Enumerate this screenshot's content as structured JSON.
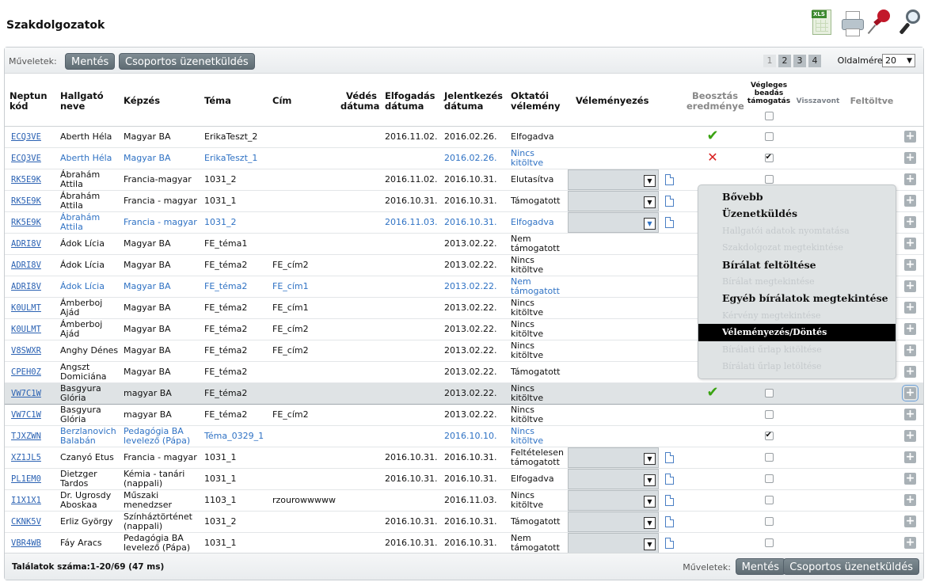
{
  "page": {
    "title": "Szakdolgozatok"
  },
  "top_icons": [
    {
      "name": "excel-export-icon",
      "label": "XLS"
    },
    {
      "name": "printer-icon"
    },
    {
      "name": "pin-icon"
    },
    {
      "name": "magnifier-icon"
    }
  ],
  "toolbar": {
    "label": "Műveletek:",
    "save": "Mentés",
    "group_message": "Csoportos üzenetküldés",
    "pages": [
      "1",
      "2",
      "3",
      "4"
    ],
    "current_page": "1",
    "page_size_label": "Oldalméret",
    "page_size_value": "20"
  },
  "columns": {
    "neptun": "Neptun kód",
    "student": "Hallgató neve",
    "program": "Képzés",
    "topic": "Téma",
    "title": "Cím",
    "defense_date": "Védés dátuma",
    "accept_date": "Elfogadás dátuma",
    "apply_date": "Jelentkezés dátuma",
    "supervisor_opinion": "Oktatói vélemény",
    "opinion": "Véleményezés",
    "assignment_result": "Beosztás eredménye",
    "final_submit": "Végleges beadás támogatás",
    "withdrawn": "Visszavont",
    "uploaded": "Feltöltve"
  },
  "rows": [
    {
      "neptun": "ECQ3VE",
      "name": "Aberth Héla",
      "program": "Magyar BA",
      "topic": "ErikaTeszt_2",
      "title": "",
      "defense": "",
      "accept": "2016.11.02.",
      "apply": "2016.02.26.",
      "opinion": "Elfogadva",
      "dropdown": false,
      "result": "check",
      "final": false,
      "blue": false
    },
    {
      "neptun": "ECQ3VE",
      "name": "Aberth Héla",
      "program": "Magyar BA",
      "topic": "ErikaTeszt_1",
      "title": "",
      "defense": "",
      "accept": "",
      "apply": "2016.02.26.",
      "opinion": "Nincs kitöltve",
      "dropdown": false,
      "result": "x",
      "final": true,
      "blue": true
    },
    {
      "neptun": "RK5E9K",
      "name": "Ábrahám Attila",
      "program": "Francia-magyar",
      "topic": "1031_2",
      "title": "",
      "defense": "",
      "accept": "2016.11.02.",
      "apply": "2016.10.31.",
      "opinion": "Elutasítva",
      "dropdown": true,
      "result": "",
      "final": false,
      "blue": false
    },
    {
      "neptun": "RK5E9K",
      "name": "Ábrahám Attila",
      "program": "Francia - magyar",
      "topic": "1031_1",
      "title": "",
      "defense": "",
      "accept": "2016.10.31.",
      "apply": "2016.10.31.",
      "opinion": "Támogatott",
      "dropdown": true,
      "result": "",
      "final": false,
      "blue": false
    },
    {
      "neptun": "RK5E9K",
      "name": "Ábrahám Attila",
      "program": "Francia - magyar",
      "topic": "1031_2",
      "title": "",
      "defense": "",
      "accept": "2016.11.03.",
      "apply": "2016.10.31.",
      "opinion": "Elfogadva",
      "dropdown": true,
      "result": "",
      "final": false,
      "blue": true
    },
    {
      "neptun": "ADRI8V",
      "name": "Ádok Lícia",
      "program": "Magyar BA",
      "topic": "FE_téma1",
      "title": "",
      "defense": "",
      "accept": "",
      "apply": "2013.02.22.",
      "opinion": "Nem támogatott",
      "dropdown": false,
      "result": "",
      "final": false,
      "blue": false
    },
    {
      "neptun": "ADRI8V",
      "name": "Ádok Lícia",
      "program": "Magyar BA",
      "topic": "FE_téma2",
      "title": "FE_cím2",
      "defense": "",
      "accept": "",
      "apply": "2013.02.22.",
      "opinion": "Nincs kitöltve",
      "dropdown": false,
      "result": "",
      "final": false,
      "blue": false
    },
    {
      "neptun": "ADRI8V",
      "name": "Ádok Lícia",
      "program": "Magyar BA",
      "topic": "FE_téma2",
      "title": "FE_cím1",
      "defense": "",
      "accept": "",
      "apply": "2013.02.22.",
      "opinion": "Nem támogatott",
      "dropdown": false,
      "result": "",
      "final": false,
      "blue": true
    },
    {
      "neptun": "K0ULMT",
      "name": "Ámberboj Ajád",
      "program": "Magyar BA",
      "topic": "FE_téma2",
      "title": "FE_cím1",
      "defense": "",
      "accept": "",
      "apply": "2013.02.22.",
      "opinion": "Nincs kitöltve",
      "dropdown": false,
      "result": "",
      "final": false,
      "blue": false
    },
    {
      "neptun": "K0ULMT",
      "name": "Ámberboj Ajád",
      "program": "Magyar BA",
      "topic": "FE_téma2",
      "title": "FE_cím2",
      "defense": "",
      "accept": "",
      "apply": "2013.02.22.",
      "opinion": "Nincs kitöltve",
      "dropdown": false,
      "result": "",
      "final": false,
      "blue": false
    },
    {
      "neptun": "V8SWXR",
      "name": "Anghy Dénes",
      "program": "Magyar BA",
      "topic": "FE_téma2",
      "title": "FE_cím2",
      "defense": "",
      "accept": "",
      "apply": "2013.02.22.",
      "opinion": "Nincs kitöltve",
      "dropdown": false,
      "result": "",
      "final": false,
      "blue": false
    },
    {
      "neptun": "CPEH0Z",
      "name": "Angszt Domiciána",
      "program": "Magyar BA",
      "topic": "FE_téma2",
      "title": "",
      "defense": "",
      "accept": "",
      "apply": "2013.02.22.",
      "opinion": "Támogatott",
      "dropdown": false,
      "result": "",
      "final": false,
      "blue": false
    },
    {
      "neptun": "VW7C1W",
      "name": "Basgyura Glória",
      "program": "magyar BA",
      "topic": "FE_téma2",
      "title": "",
      "defense": "",
      "accept": "",
      "apply": "2013.02.22.",
      "opinion": "Nincs kitöltve",
      "dropdown": false,
      "result": "check",
      "final": false,
      "blue": false,
      "selected": true
    },
    {
      "neptun": "VW7C1W",
      "name": "Basgyura Glória",
      "program": "magyar BA",
      "topic": "FE_téma2",
      "title": "FE_cím2",
      "defense": "",
      "accept": "",
      "apply": "2013.02.22.",
      "opinion": "Nincs kitöltve",
      "dropdown": false,
      "result": "",
      "final": false,
      "blue": false
    },
    {
      "neptun": "TJXZWN",
      "name": "Berzlanovich Balabán",
      "program": "Pedagógia BA levelező (Pápa)",
      "topic": "Téma_0329_1",
      "title": "",
      "defense": "",
      "accept": "",
      "apply": "2016.10.10.",
      "opinion": "Nincs kitöltve",
      "dropdown": false,
      "result": "",
      "final": true,
      "blue": true
    },
    {
      "neptun": "XZ1JL5",
      "name": "Czanyó Etus",
      "program": "Francia - magyar",
      "topic": "1031_1",
      "title": "",
      "defense": "",
      "accept": "2016.10.31.",
      "apply": "2016.10.31.",
      "opinion": "Feltételesen támogatott",
      "dropdown": true,
      "result": "",
      "final": false,
      "blue": false
    },
    {
      "neptun": "PL1EM0",
      "name": "Dietzger Tardos",
      "program": "Kémia - tanári (nappali)",
      "topic": "1031_1",
      "title": "",
      "defense": "",
      "accept": "2016.10.31.",
      "apply": "2016.10.31.",
      "opinion": "Elfogadva",
      "dropdown": true,
      "result": "",
      "final": false,
      "blue": false
    },
    {
      "neptun": "I1X1X1",
      "name": "Dr. Ugrosdy Aboskaa",
      "program": "Műszaki menedzser",
      "topic": "1103_1",
      "title": "rzourowwwww...",
      "defense": "",
      "accept": "",
      "apply": "2016.11.03.",
      "opinion": "Nincs kitöltve",
      "dropdown": true,
      "result": "",
      "final": false,
      "blue": false
    },
    {
      "neptun": "CKNK5V",
      "name": "Erliz György",
      "program": "Színháztörténet (nappali)",
      "topic": "1031_2",
      "title": "",
      "defense": "",
      "accept": "2016.10.31.",
      "apply": "2016.10.31.",
      "opinion": "Támogatott",
      "dropdown": true,
      "result": "",
      "final": false,
      "blue": false
    },
    {
      "neptun": "VBR4WB",
      "name": "Fáy Aracs",
      "program": "Pedagógia BA levelező (Pápa)",
      "topic": "1031_1",
      "title": "",
      "defense": "",
      "accept": "2016.10.31.",
      "apply": "2016.10.31.",
      "opinion": "Nem támogatott",
      "dropdown": true,
      "result": "",
      "final": false,
      "blue": false
    }
  ],
  "context_menu": [
    {
      "label": "Bővebb",
      "state": "enabled"
    },
    {
      "label": "Üzenetküldés",
      "state": "enabled"
    },
    {
      "label": "Hallgatói adatok nyomtatása",
      "state": "disabled"
    },
    {
      "label": "Szakdolgozat megtekintése",
      "state": "disabled"
    },
    {
      "label": "Bírálat feltöltése",
      "state": "enabled"
    },
    {
      "label": "Bírálat megtekintése",
      "state": "disabled"
    },
    {
      "label": "Egyéb bírálatok megtekintése",
      "state": "enabled"
    },
    {
      "label": "Kérvény megtekintése",
      "state": "disabled"
    },
    {
      "label": "Véleményezés/Döntés",
      "state": "active"
    },
    {
      "label": "Bírálati űrlap kitöltése",
      "state": "disabled"
    },
    {
      "label": "Bírálati űrlap letöltése",
      "state": "disabled"
    }
  ],
  "footer": {
    "count_text": "Találatok száma:1-20/69 (47 ms)",
    "label": "Műveletek:",
    "save": "Mentés",
    "group_message": "Csoportos üzenetküldés"
  }
}
